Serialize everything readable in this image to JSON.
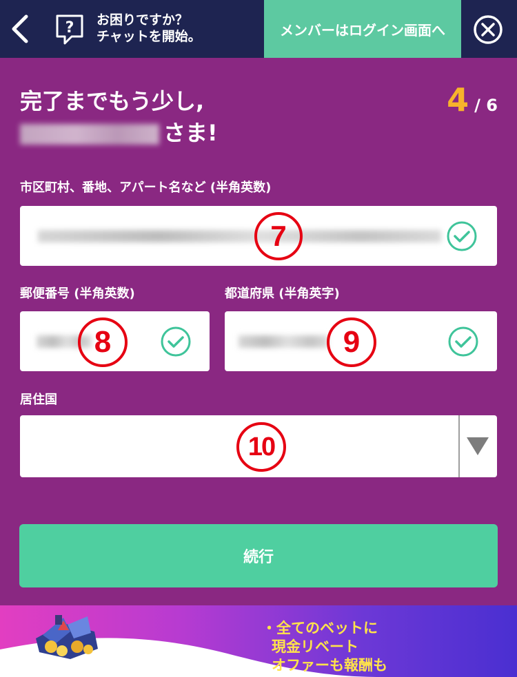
{
  "topbar": {
    "help_line1": "お困りですか？",
    "help_line2": "チャットを開始。",
    "login_label": "メンバーはログイン画面へ"
  },
  "header": {
    "title_line1": "完了までもう少し,",
    "title_line2_suffix": "さま!",
    "step_current": "4",
    "step_total": "/ 6"
  },
  "form": {
    "address_label": "市区町村、番地、アパート名など (半角英数)",
    "postal_label": "郵便番号 (半角英数)",
    "prefecture_label": "都道府県 (半角英字)",
    "country_label": "居住国",
    "markers": {
      "address": "7",
      "postal": "8",
      "prefecture": "9",
      "country": "10"
    },
    "continue_label": "続行"
  },
  "banner": {
    "line1": "・全てのベットに",
    "line2": "現金リベート",
    "line3": "オファーも報酬も"
  },
  "colors": {
    "background": "#8a2882",
    "topbar": "#1e2451",
    "login_button": "#5dc9a1",
    "continue_button": "#4fcfa0",
    "step_accent": "#f7b32b",
    "check": "#3fc49a",
    "marker": "#e60012"
  }
}
